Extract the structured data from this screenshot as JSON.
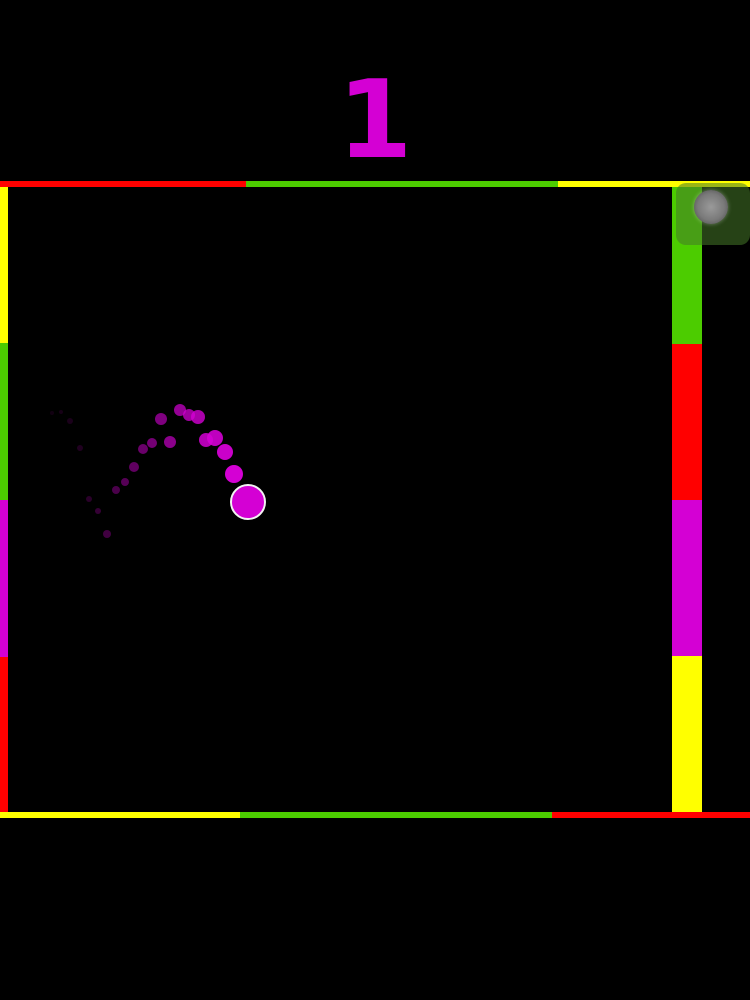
{
  "score": "1",
  "colors": {
    "background": "#000000",
    "red": "#ff0000",
    "green": "#4ccc00",
    "yellow": "#ffff00",
    "magenta": "#d400d4"
  },
  "walls": {
    "top": [
      "red",
      "green",
      "yellow"
    ],
    "bottom": [
      "yellow",
      "green",
      "red"
    ],
    "left": [
      "yellow",
      "green",
      "magenta",
      "red"
    ],
    "right_paddle": [
      "green",
      "red",
      "magenta",
      "yellow"
    ]
  },
  "ball": {
    "color": "magenta"
  },
  "pause_control": {
    "icon": "pause-knob-icon"
  }
}
